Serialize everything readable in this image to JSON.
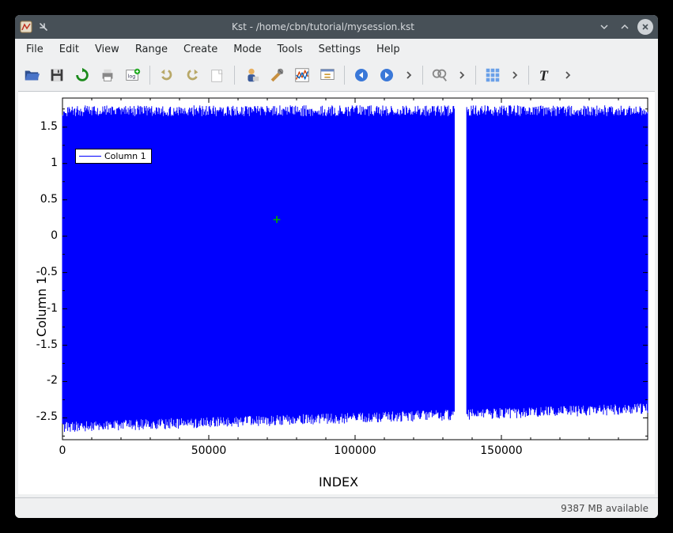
{
  "window": {
    "title": "Kst - /home/cbn/tutorial/mysession.kst"
  },
  "menu": {
    "items": [
      "File",
      "Edit",
      "View",
      "Range",
      "Create",
      "Mode",
      "Tools",
      "Settings",
      "Help"
    ]
  },
  "toolbar": {
    "open": "Open",
    "save": "Save",
    "reload": "Reload",
    "print": "Print",
    "log": "Log",
    "undo": "Undo",
    "redo": "Redo",
    "new_tab": "New Tab",
    "data_mgr": "Data Manager",
    "edit_obj": "Change Data File",
    "edit_plot": "Edit Vectors",
    "dialog": "New Curve",
    "back": "Back",
    "forward": "Forward",
    "maximize": "Tied Zoom",
    "layout": "Layout",
    "text": "Text"
  },
  "status": {
    "memory": "9387 MB available"
  },
  "chart_data": {
    "type": "line",
    "title": "",
    "xlabel": "INDEX",
    "ylabel": "Column 1",
    "legend": [
      "Column 1"
    ],
    "series": [
      {
        "name": "Column 1",
        "description": "Dense oscillatory signal across full index range",
        "amplitude_top": 1.8,
        "amplitude_bottom": -2.7,
        "gap_region": [
          134000,
          138000
        ],
        "n_points_approx": 200000,
        "color": "#0000ff"
      }
    ],
    "x_ticks": [
      0,
      50000,
      100000,
      150000
    ],
    "y_ticks": [
      -2.5,
      -2,
      -1.5,
      -1,
      -0.5,
      0,
      0.5,
      1,
      1.5
    ],
    "xlim": [
      0,
      200000
    ],
    "ylim": [
      -2.8,
      1.9
    ],
    "cursor_marker": {
      "x": 73000,
      "y": 0.2
    }
  }
}
